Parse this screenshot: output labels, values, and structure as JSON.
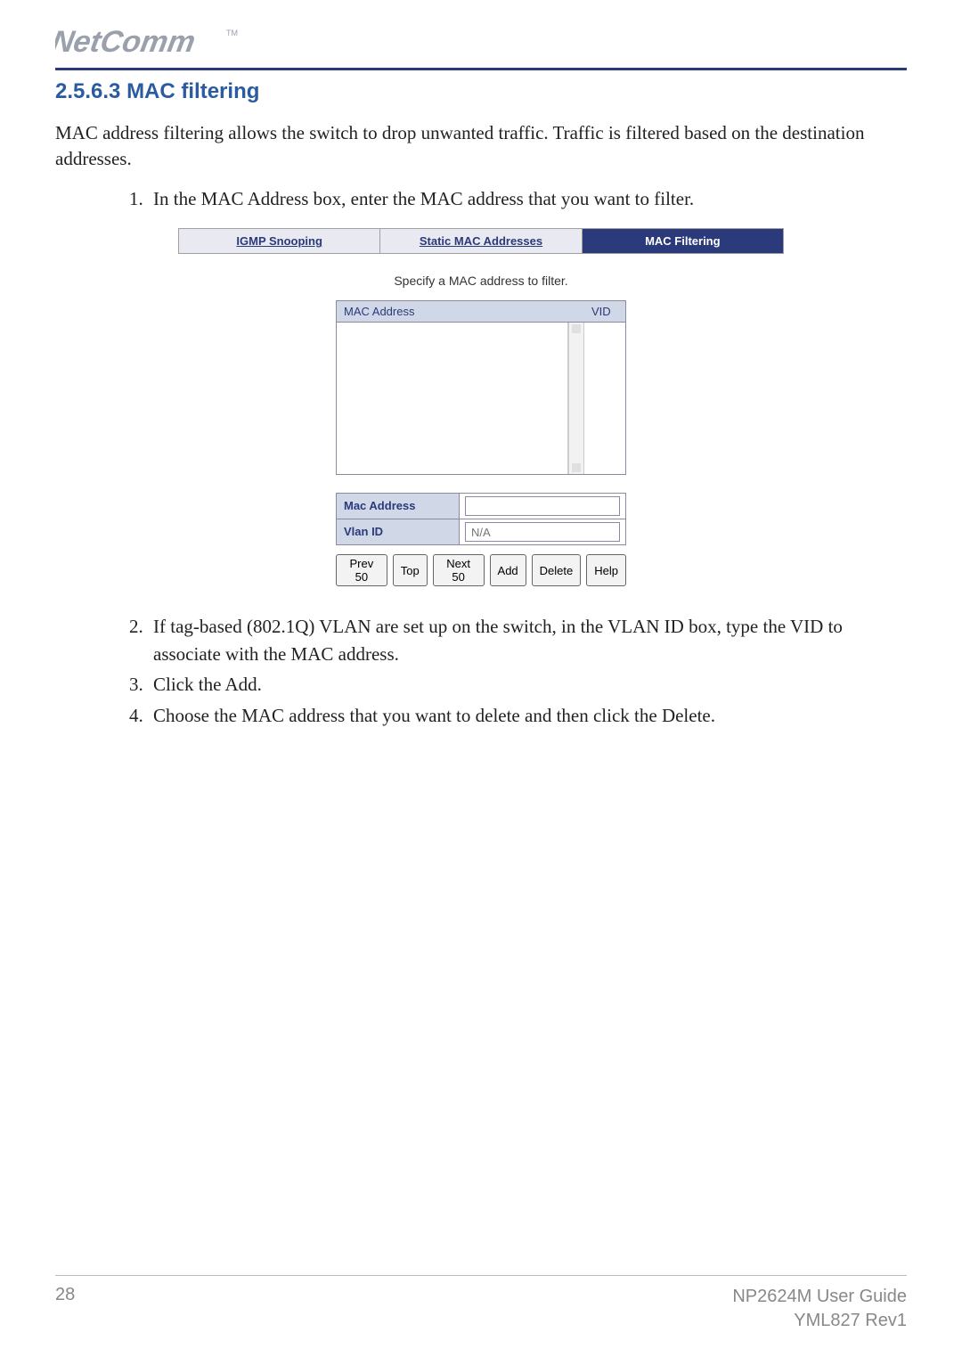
{
  "brand": {
    "name": "NetComm",
    "tm": "TM"
  },
  "section": {
    "heading": "2.5.6.3 MAC filtering"
  },
  "intro": "MAC address filtering allows the switch to drop unwanted traffic.  Traffic is filtered based on the destination addresses.",
  "steps_a": [
    "In the MAC Address box, enter the MAC address that you want to filter."
  ],
  "steps_b": [
    "If tag-based (802.1Q) VLAN are set up on the switch, in the VLAN ID box, type the VID to associate with the MAC address.",
    "Click the Add.",
    "Choose the MAC address that you want to delete and then click the Delete."
  ],
  "ui": {
    "tabs": {
      "igmp": "IGMP Snooping",
      "static": "Static MAC Addresses",
      "filtering": "MAC Filtering"
    },
    "caption": "Specify a MAC address to filter.",
    "listbox": {
      "col_mac": "MAC Address",
      "col_vid": "VID"
    },
    "form": {
      "mac_label": "Mac Address",
      "mac_value": "",
      "vlan_label": "Vlan ID",
      "vlan_placeholder": "N/A"
    },
    "buttons": {
      "prev": "Prev 50",
      "top": "Top",
      "next": "Next 50",
      "add": "Add",
      "delete": "Delete",
      "help": "Help"
    }
  },
  "footer": {
    "page_num": "28",
    "guide": "NP2624M User Guide",
    "rev": "YML827 Rev1"
  }
}
